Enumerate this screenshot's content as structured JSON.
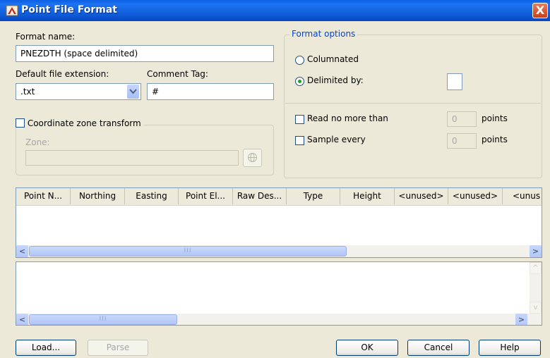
{
  "window": {
    "title": "Point File Format",
    "close_glyph": "X"
  },
  "left": {
    "format_name_label": "Format name:",
    "format_name_value": "PNEZDTH (space delimited)",
    "default_ext_label": "Default file extension:",
    "default_ext_value": ".txt",
    "comment_tag_label": "Comment Tag:",
    "comment_tag_value": "#",
    "coord_zone_label": "Coordinate zone transform",
    "zone_label": "Zone:",
    "zone_value": ""
  },
  "format_options": {
    "title": "Format options",
    "columnated_label": "Columnated",
    "delimited_label": "Delimited by:",
    "delimited_value": "",
    "selected": "delimited",
    "read_no_more_label": "Read no more than",
    "read_no_more_value": "0",
    "read_no_more_unit": "points",
    "sample_every_label": "Sample every",
    "sample_every_value": "0",
    "sample_every_unit": "points"
  },
  "grid": {
    "columns": [
      "Point N...",
      "Northing",
      "Easting",
      "Point El...",
      "Raw Des...",
      "Type",
      "Height",
      "<unused>",
      "<unused>",
      "<unus"
    ]
  },
  "buttons": {
    "load": "Load...",
    "parse": "Parse",
    "ok": "OK",
    "cancel": "Cancel",
    "help": "Help"
  },
  "colors": {
    "title_bar": "#0A5FE3",
    "group_title": "#0046D5",
    "dialog_bg": "#ECE9D8"
  },
  "icons": {
    "app": "autocad-icon",
    "zone_picker": "globe-icon"
  }
}
